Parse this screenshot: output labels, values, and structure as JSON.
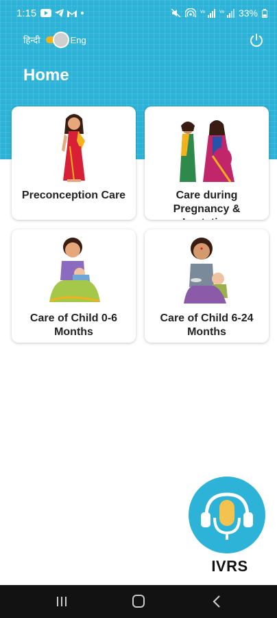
{
  "status_bar": {
    "time": "1:15",
    "icons": [
      "youtube-icon",
      "telegram-icon",
      "gmail-icon",
      "dot-icon"
    ],
    "right_icons": [
      "mute-icon",
      "hotspot-icon",
      "signal-icon",
      "signal-icon"
    ],
    "battery": "33%"
  },
  "header": {
    "lang_left": "हिन्दी",
    "lang_right": "Eng",
    "title": "Home",
    "accent_color": "#2db2d8",
    "toggle_color": "#f3b11c"
  },
  "cards": [
    {
      "label": "Preconception Care",
      "icon": "woman-in-saree-illustration"
    },
    {
      "label": "Care during Pregnancy & Lactation",
      "icon": "pregnant-women-illustration"
    },
    {
      "label": "Care of Child 0-6 Months",
      "icon": "mother-breastfeeding-illustration"
    },
    {
      "label": "Care of Child 6-24 Months",
      "icon": "mother-feeding-child-illustration"
    }
  ],
  "ivrs": {
    "label": "IVRS",
    "icon": "headset-mic-icon"
  },
  "nav": [
    "recents-icon",
    "home-icon",
    "back-icon"
  ]
}
